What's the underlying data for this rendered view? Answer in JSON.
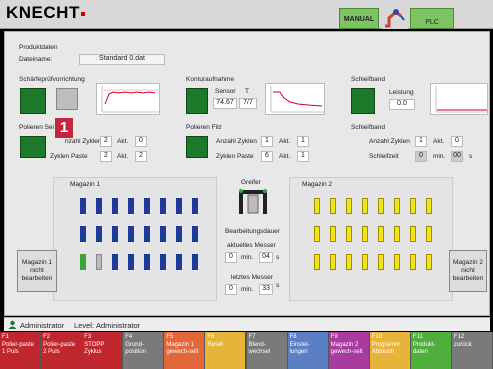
{
  "header": {
    "logo": "KNECHT",
    "mode_manual": "MANUAL",
    "mode_plc": "PLC"
  },
  "product": {
    "section_label": "Produktdaten",
    "filename_label": "Dateiname:",
    "filename_value": "Standard 0.dat"
  },
  "sharpening_check": {
    "title": "Schärfeprüfvorrichtung"
  },
  "contour": {
    "title": "Konturaufnahme",
    "sensor_label": "Sensor",
    "t_label": "T",
    "sensor_value": "74.67",
    "t_value": "7/7"
  },
  "grinding_belt": {
    "title": "Schleifband",
    "power_label": "Leistung",
    "power_value": "0.0"
  },
  "polish_side": {
    "title": "Polieren Sei",
    "cycles_label": "nzahl Zyklen",
    "cycles_value": "2",
    "akt_label": "Akt.",
    "akt_value": "0",
    "paste_cycles_label": "Zyklen Paste",
    "paste_value": "2",
    "paste_akt_label": "Akt.",
    "paste_akt_value": "2"
  },
  "polish_felt": {
    "title": "Polieren Filz",
    "cycles_label": "Anzahl Zyklen",
    "cycles_value": "1",
    "akt_label": "Akt.",
    "akt_value": "1",
    "paste_cycles_label": "Zyklen Paste",
    "paste_value": "6",
    "paste_akt_label": "Akt.",
    "paste_akt_value": "1"
  },
  "belt2": {
    "title": "Schleifband",
    "cycles_label": "Anzahl Zyklen",
    "cycles_value": "1",
    "akt_label": "Akt.",
    "akt_value": "0",
    "time_label": "Schleifzeit",
    "time_min": "0",
    "min_label": "min.",
    "time_sec": "00",
    "s_label": "s"
  },
  "magazine1": {
    "title": "Magazin 1",
    "button": "Magazin 1 nicht bearbeiten"
  },
  "gripper": {
    "title": "Greifer"
  },
  "processing": {
    "title": "Bearbeitungsdauer",
    "current_label": "aktuelles Messer",
    "current_min": "0",
    "min_label": "min.",
    "current_sec": "04",
    "s_label": "s",
    "last_label": "letztes Messer",
    "last_min": "0",
    "last_min_label": "min.",
    "last_sec": "33",
    "last_s_label": "s"
  },
  "magazine2": {
    "title": "Magazin 2",
    "button": "Magazin 2 nicht bearbeiten"
  },
  "badge": "1",
  "status": {
    "user": "Administrator",
    "level_label": "Level:",
    "level": "Administrator"
  },
  "fkeys": [
    {
      "num": "F1",
      "label": "Polier-paste 1 Puls",
      "color": "#c0262e"
    },
    {
      "num": "F2",
      "label": "Polier-paste 2 Puls",
      "color": "#c0262e"
    },
    {
      "num": "F3",
      "label": "STOPP Zyklus",
      "color": "#c0262e"
    },
    {
      "num": "F4",
      "label": "Grund-position",
      "color": "#7a7a7a"
    },
    {
      "num": "F5",
      "label": "Magazin 1 gewech-selt",
      "color": "#e2683a"
    },
    {
      "num": "F6",
      "label": "Reset",
      "color": "#e7b43a"
    },
    {
      "num": "F7",
      "label": "Blend-wechsel",
      "color": "#7a7a7a"
    },
    {
      "num": "F8",
      "label": "Einstel-lungen",
      "color": "#5b7fc5"
    },
    {
      "num": "F9",
      "label": "Magazin 2 gewech-selt",
      "color": "#a83aa0"
    },
    {
      "num": "F10",
      "label": "Programm Abbruch",
      "color": "#e7b43a"
    },
    {
      "num": "F11",
      "label": "Produkt-daten",
      "color": "#4fae3c"
    },
    {
      "num": "F12",
      "label": "zurück",
      "color": "#7a7a7a"
    }
  ]
}
